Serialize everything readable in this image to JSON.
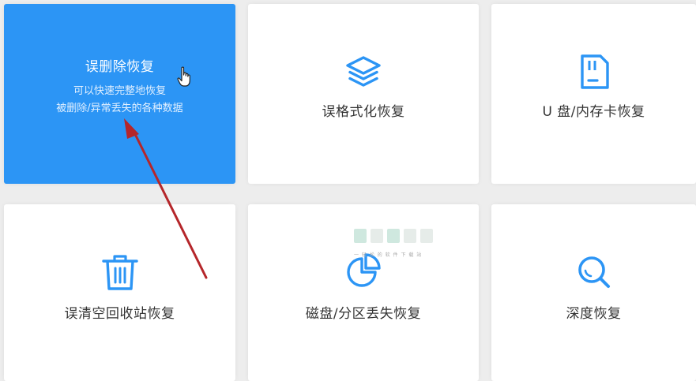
{
  "cards": [
    {
      "label": "误删除恢复",
      "desc_line1": "可以快速完整地恢复",
      "desc_line2": "被删除/异常丢失的各种数据",
      "icon": "none",
      "selected": true
    },
    {
      "label": "误格式化恢复",
      "icon": "layers-icon"
    },
    {
      "label": "U 盘/内存卡恢复",
      "icon": "sd-card-icon"
    },
    {
      "label": "误清空回收站恢复",
      "icon": "trash-icon"
    },
    {
      "label": "磁盘/分区丢失恢复",
      "icon": "pie-chart-icon"
    },
    {
      "label": "深度恢复",
      "icon": "search-icon"
    }
  ],
  "colors": {
    "accent": "#2c95f5",
    "selected_card_bg": "#2c95f5",
    "icon": "#2c95f5",
    "arrow": "#b5262a"
  },
  "annotation": {
    "type": "red-arrow",
    "points_to": "误删除恢复"
  },
  "watermark_text": "一 轻 松 的 软 件 下 载 站"
}
